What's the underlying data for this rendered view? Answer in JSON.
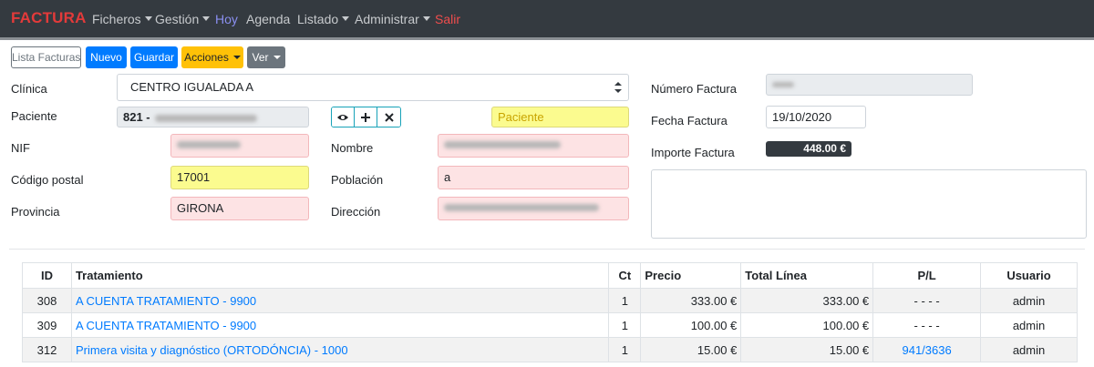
{
  "navbar": {
    "brand": "FACTURA",
    "items": [
      {
        "label": "Ficheros"
      },
      {
        "label": "Gestión"
      },
      {
        "label": "Hoy"
      },
      {
        "label": "Agenda"
      },
      {
        "label": "Listado"
      },
      {
        "label": "Administrar"
      },
      {
        "label": "Salir"
      }
    ]
  },
  "toolbar": {
    "lista_facturas": "Lista Facturas",
    "nuevo": "Nuevo",
    "guardar": "Guardar",
    "acciones": "Acciones",
    "ver": "Ver"
  },
  "form": {
    "clinica_label": "Clínica",
    "clinica_value": "CENTRO IGUALADA A",
    "paciente_label": "Paciente",
    "paciente_value": "821 -",
    "paciente_search_placeholder": "Paciente",
    "nif_label": "NIF",
    "nombre_label": "Nombre",
    "codigo_postal_label": "Código postal",
    "codigo_postal_value": "17001",
    "poblacion_label": "Población",
    "poblacion_value": "a",
    "provincia_label": "Provincia",
    "provincia_value": "GIRONA",
    "direccion_label": "Dirección",
    "numero_factura_label": "Número Factura",
    "fecha_factura_label": "Fecha Factura",
    "fecha_factura_value": "19/10/2020",
    "importe_factura_label": "Importe Factura",
    "importe_factura_value": "448.00 €"
  },
  "table": {
    "headers": [
      "ID",
      "Tratamiento",
      "Ct",
      "Precio",
      "Total Línea",
      "P/L",
      "Usuario"
    ],
    "rows": [
      {
        "id": "308",
        "tratamiento": "A CUENTA TRATAMIENTO - 9900",
        "ct": "1",
        "precio": "333.00 €",
        "total": "333.00 €",
        "pl": "- - - -",
        "usuario": "admin"
      },
      {
        "id": "309",
        "tratamiento": "A CUENTA TRATAMIENTO - 9900",
        "ct": "1",
        "precio": "100.00 €",
        "total": "100.00 €",
        "pl": "- - - -",
        "usuario": "admin"
      },
      {
        "id": "312",
        "tratamiento": "Primera visita y diagnóstico (ORTODÓNCIA) - 1000",
        "ct": "1",
        "precio": "15.00 €",
        "total": "15.00 €",
        "pl": "941/3636",
        "usuario": "admin"
      }
    ]
  },
  "colors": {
    "navbar_bg": "#343a40",
    "brand": "#e33a3a",
    "primary": "#007bff",
    "warning": "#ffc107",
    "secondary": "#6c757d",
    "field_pink": "#fde3e4",
    "field_yellow": "#fbfb8f"
  }
}
